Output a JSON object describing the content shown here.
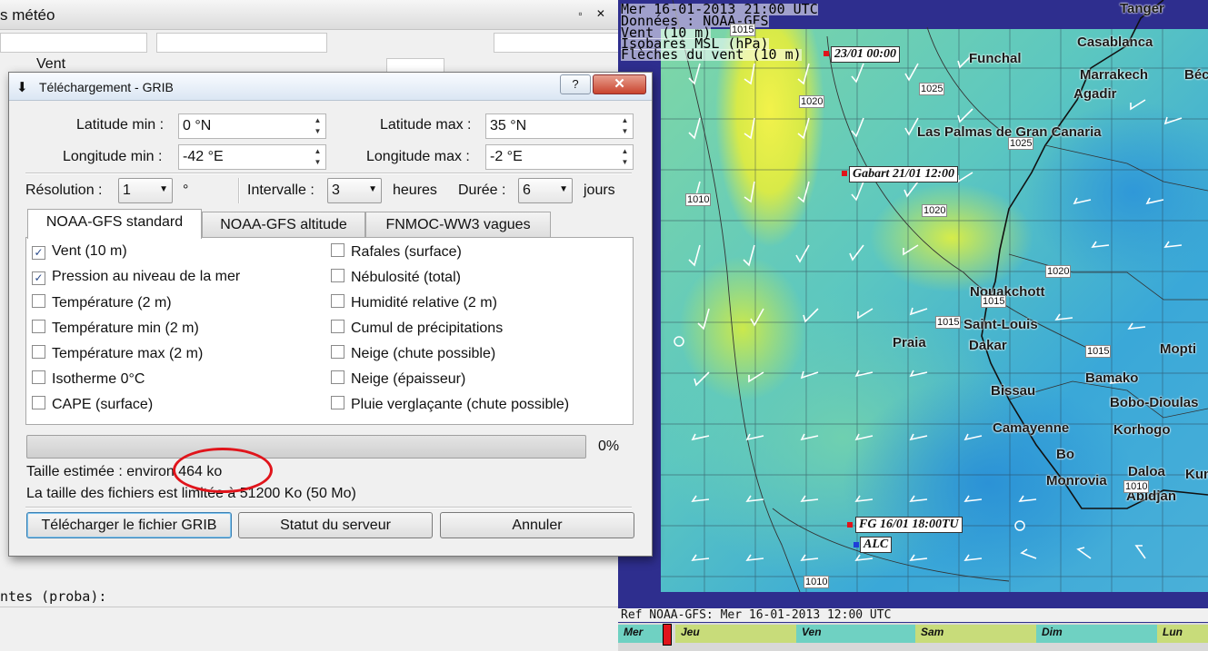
{
  "background_panel": {
    "title": "s météo",
    "vent_label": "Vent",
    "bottom_text": "ntes (proba):"
  },
  "map": {
    "header_lines": [
      "Mer 16-01-2013 21:00 UTC",
      "Données : NOAA-GFS",
      "Vent (10 m)",
      "Isobares MSL (hPa)",
      "Flèches du vent (10 m)"
    ],
    "cities": [
      "Tanger",
      "Casablanca",
      "Funchal",
      "Marrakech",
      "Béch",
      "Agadir",
      "Las Palmas de Gran Canaria",
      "Nouakchott",
      "Saint-Louis",
      "Praia",
      "Dakar",
      "Mopti",
      "Bamako",
      "Bissau",
      "Bobo-Dioulas",
      "Korhogo",
      "Camayenne",
      "Bo",
      "Monrovia",
      "Daloa",
      "Kum",
      "Abidjan"
    ],
    "isobars": [
      "1015",
      "1025",
      "1020",
      "1025",
      "1010",
      "1020",
      "1020",
      "1015",
      "1015",
      "1015",
      "1010",
      "1010"
    ],
    "boats": {
      "marker1": "23/01 00:00",
      "gabart": "Gabart 21/01 12:00",
      "fg": "FG 16/01 18:00TU",
      "alc": "ALC"
    },
    "colors": {
      "marker_red": "#e0141b",
      "marker_blue": "#1f3fd8"
    },
    "ref_text": "Ref NOAA-GFS: Mer 16-01-2013 12:00 UTC",
    "timeline_days": [
      "Mer",
      "Jeu",
      "Ven",
      "Sam",
      "Dim",
      "Lun"
    ]
  },
  "dialog": {
    "title": "Téléchargement - GRIB",
    "help_label": "?",
    "close_label": "✕",
    "lat_min_label": "Latitude min :",
    "lat_min_value": "0 °N",
    "lat_max_label": "Latitude max :",
    "lat_max_value": "35 °N",
    "lon_min_label": "Longitude min :",
    "lon_min_value": "-42 °E",
    "lon_max_label": "Longitude max :",
    "lon_max_value": "-2 °E",
    "resolution_label": "Résolution :",
    "resolution_value": "1",
    "resolution_unit": "°",
    "interval_label": "Intervalle :",
    "interval_value": "3",
    "interval_unit": "heures",
    "duration_label": "Durée :",
    "duration_value": "6",
    "duration_unit": "jours",
    "tabs": [
      "NOAA-GFS standard",
      "NOAA-GFS altitude",
      "FNMOC-WW3 vagues"
    ],
    "checkboxes_left": [
      {
        "label": "Vent (10 m)",
        "checked": true
      },
      {
        "label": "Pression au niveau de la mer",
        "checked": true
      },
      {
        "label": "Température (2 m)",
        "checked": false
      },
      {
        "label": "Température min (2 m)",
        "checked": false
      },
      {
        "label": "Température max (2 m)",
        "checked": false
      },
      {
        "label": "Isotherme 0°C",
        "checked": false
      },
      {
        "label": "CAPE (surface)",
        "checked": false
      }
    ],
    "checkboxes_right": [
      {
        "label": "Rafales (surface)",
        "checked": false
      },
      {
        "label": "Nébulosité (total)",
        "checked": false
      },
      {
        "label": "Humidité relative (2 m)",
        "checked": false
      },
      {
        "label": "Cumul de précipitations",
        "checked": false
      },
      {
        "label": "Neige (chute possible)",
        "checked": false
      },
      {
        "label": "Neige (épaisseur)",
        "checked": false
      },
      {
        "label": "Pluie verglaçante (chute possible)",
        "checked": false
      }
    ],
    "progress_value": 0,
    "progress_text": "0%",
    "size_estimate": "Taille estimée : environ 464 ko",
    "size_limit": "La taille des fichiers est limitée à 51200 Ko (50 Mo)",
    "buttons": {
      "download": "Télécharger le fichier GRIB",
      "server_status": "Statut du serveur",
      "cancel": "Annuler"
    }
  }
}
